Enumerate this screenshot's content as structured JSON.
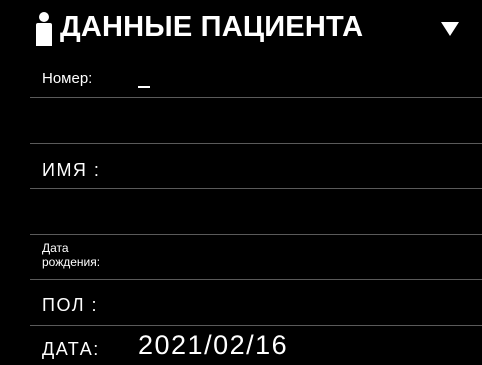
{
  "header": {
    "title": "ДАННЫЕ ПАЦИЕНТА",
    "icon": "person-icon",
    "dropdown_icon": "triangle-down-icon"
  },
  "fields": {
    "number": {
      "label": "Номер:",
      "value": ""
    },
    "name": {
      "label": "ИМЯ :",
      "value": ""
    },
    "birth_date": {
      "label_line1": "Дата",
      "label_line2": "рождения:",
      "value": ""
    },
    "sex": {
      "label": "ПОЛ :",
      "value": ""
    },
    "date": {
      "label": "ДАТА:",
      "value": "2021/02/16"
    }
  },
  "colors": {
    "background": "#000000",
    "text": "#ffffff",
    "divider": "#5a5a5a"
  }
}
